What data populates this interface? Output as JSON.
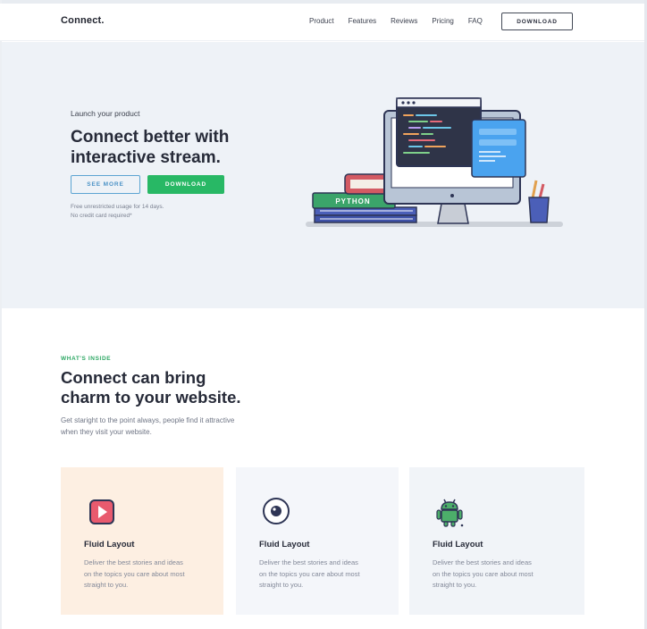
{
  "nav": {
    "logo": "Connect.",
    "links": [
      "Product",
      "Features",
      "Reviews",
      "Pricing",
      "FAQ"
    ],
    "download": "DOWNLOAD"
  },
  "hero": {
    "eyebrow": "Launch your product",
    "title_line1": "Connect better with",
    "title_line2": "interactive stream.",
    "see_more": "SEE MORE",
    "download": "DOWNLOAD",
    "note_line1": "Free unrestricted usage for 14 days.",
    "note_line2": "No credit card required*",
    "book_label": "PYTHON"
  },
  "section": {
    "kicker": "WHAT'S INSIDE",
    "title_line1": "Connect can bring",
    "title_line2": "charm to your website.",
    "desc_line1": "Get staright to the point always, people find it attractive",
    "desc_line2": "when they visit your website."
  },
  "cards": [
    {
      "title": "Fluid Layout",
      "desc_line1": "Deliver the best stories and ideas",
      "desc_line2": "on the topics you care about most",
      "desc_line3": "straight to you.",
      "icon": "video-play-icon"
    },
    {
      "title": "Fluid Layout",
      "desc_line1": "Deliver the best stories and ideas",
      "desc_line2": "on the topics you care about most",
      "desc_line3": "straight to you.",
      "icon": "camera-lens-icon"
    },
    {
      "title": "Fluid Layout",
      "desc_line1": "Deliver the best stories and ideas",
      "desc_line2": "on the topics you care about most",
      "desc_line3": "straight to you.",
      "icon": "android-icon"
    }
  ],
  "colors": {
    "accent_green": "#28b865",
    "accent_blue": "#4b92c6",
    "hero_bg": "#eef2f7",
    "card1_bg": "#fdefe2"
  }
}
